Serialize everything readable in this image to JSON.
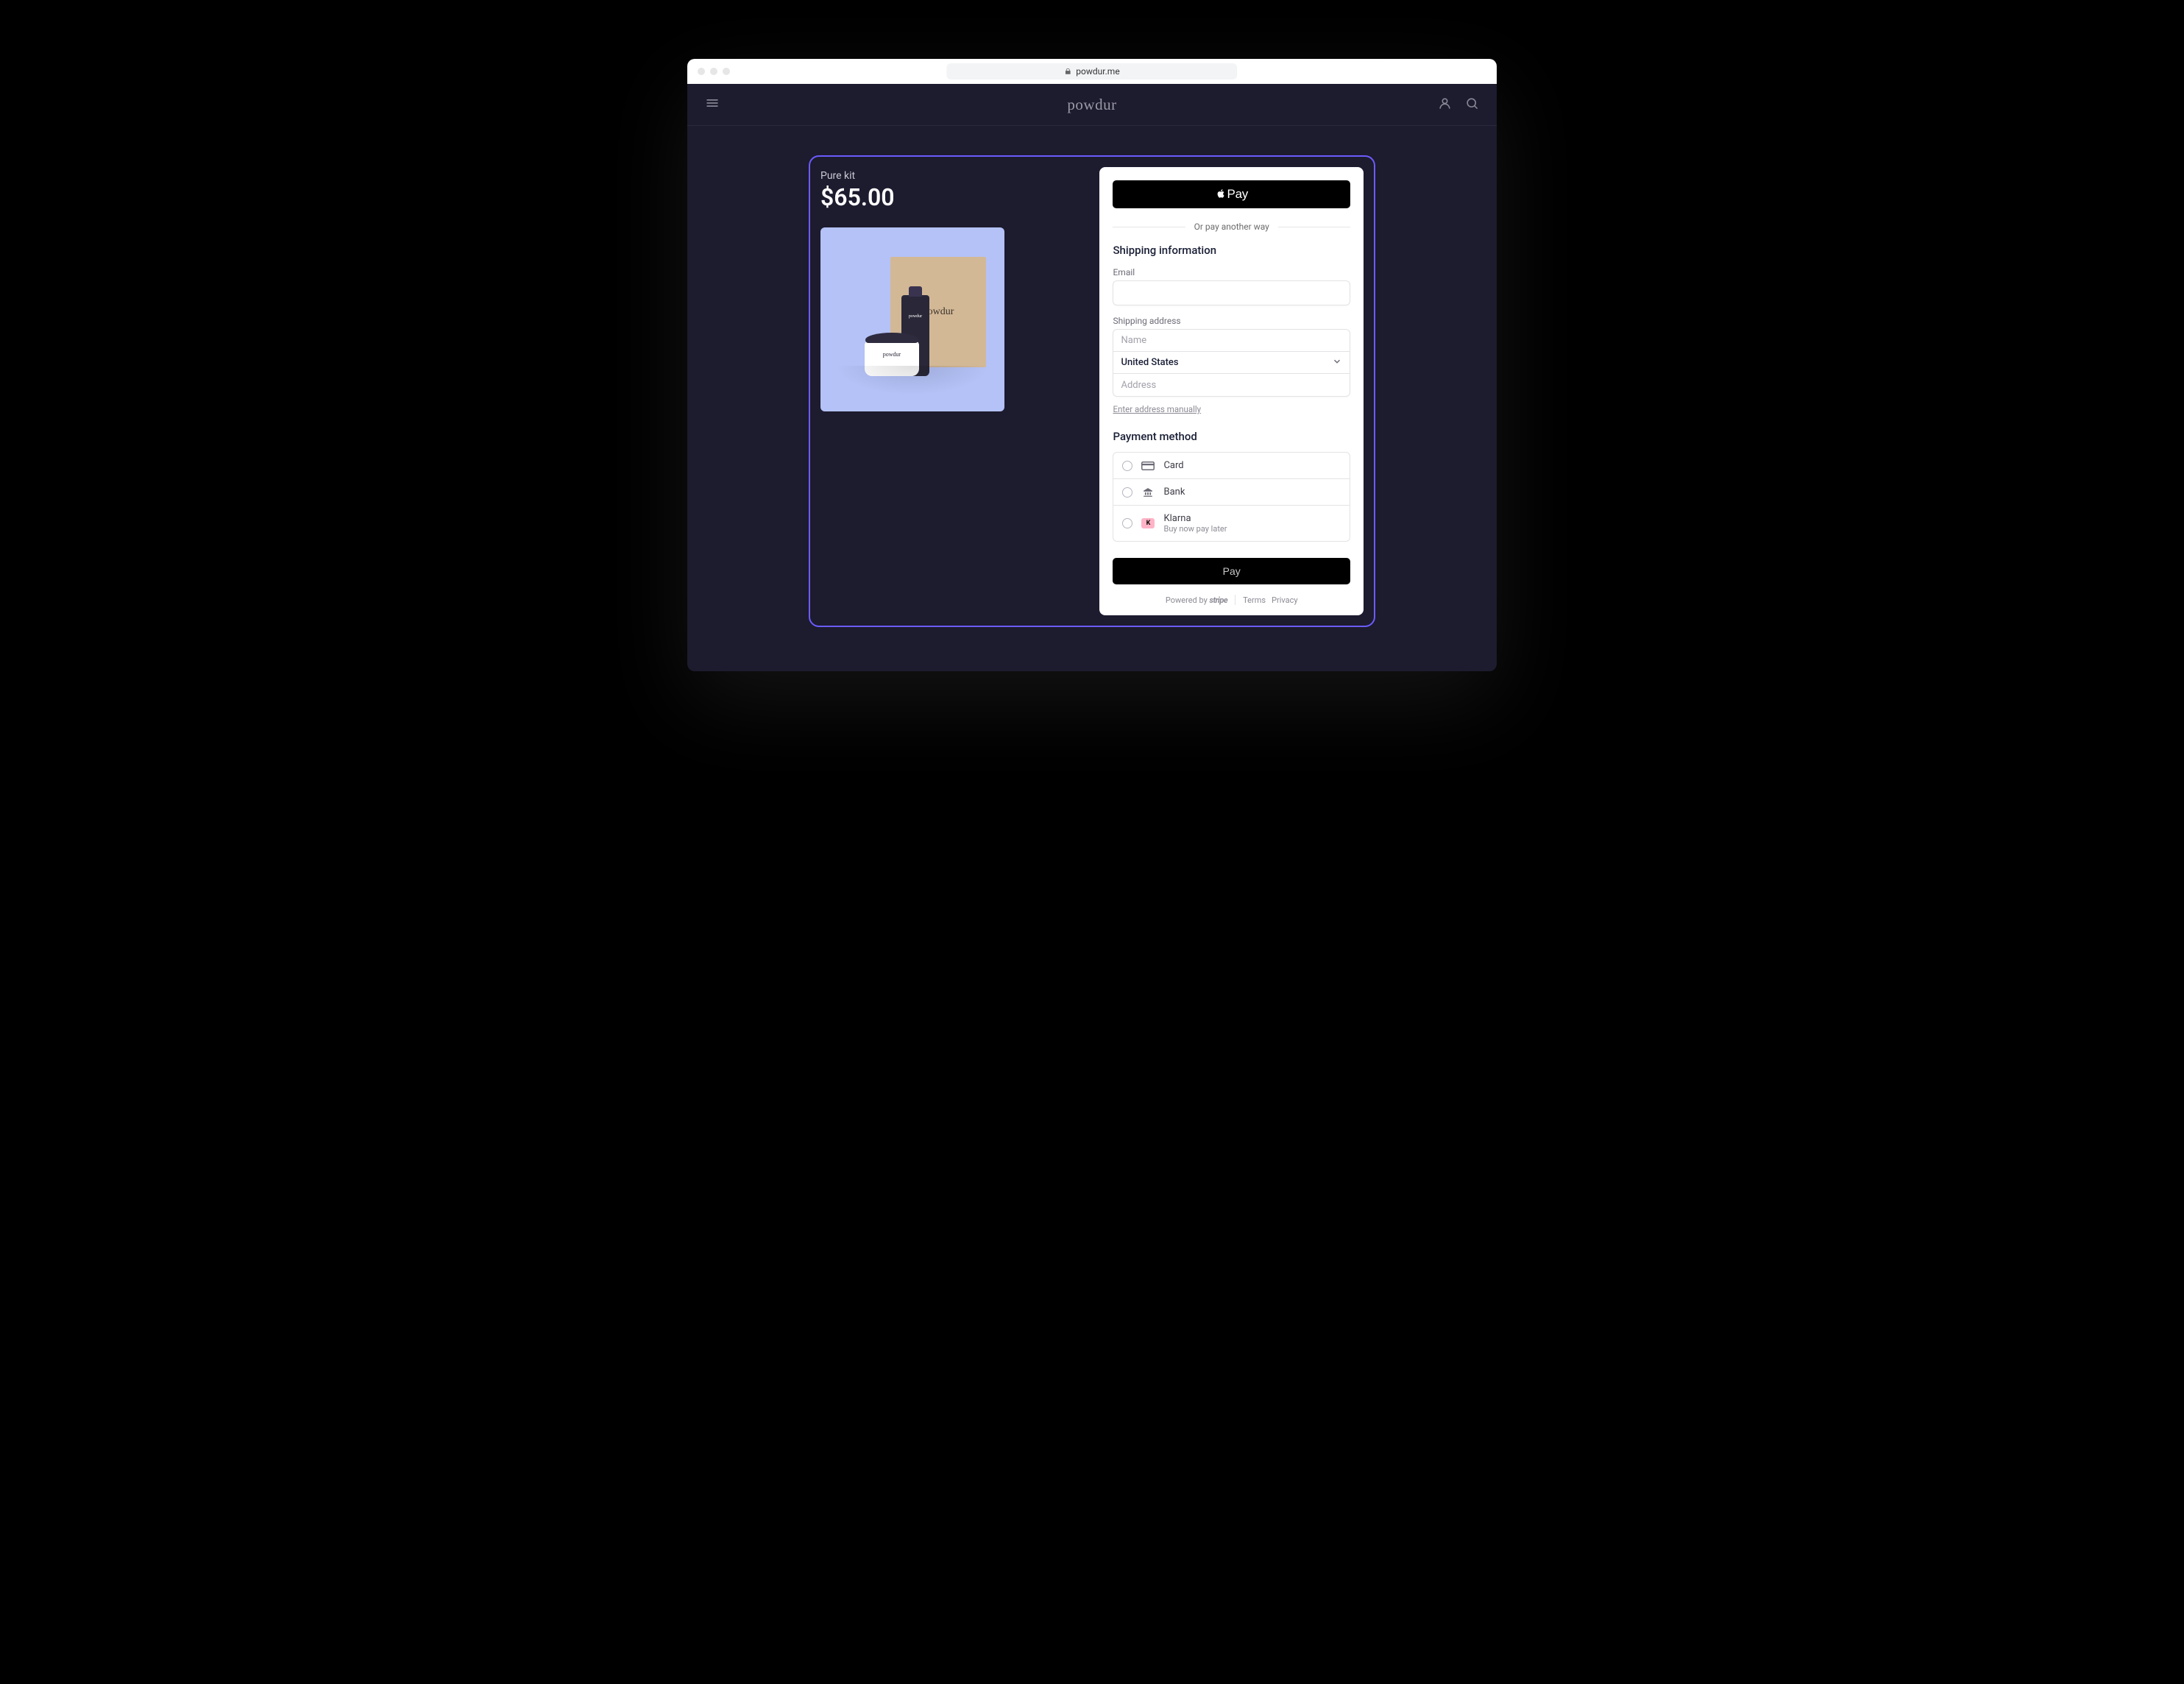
{
  "browser": {
    "url": "powdur.me"
  },
  "header": {
    "brand": "powdur"
  },
  "product": {
    "name": "Pure kit",
    "price": "$65.00"
  },
  "checkout": {
    "apple_pay_label": "Pay",
    "divider": "Or pay another way",
    "shipping_title": "Shipping information",
    "email_label": "Email",
    "email_value": "",
    "shipping_address_label": "Shipping address",
    "name_placeholder": "Name",
    "country_value": "United States",
    "address_placeholder": "Address",
    "manual_link": "Enter address manually",
    "payment_title": "Payment method",
    "methods": [
      {
        "name": "Card",
        "sub": ""
      },
      {
        "name": "Bank",
        "sub": ""
      },
      {
        "name": "Klarna",
        "sub": "Buy now pay later"
      }
    ],
    "pay_button": "Pay",
    "footer": {
      "powered_by": "Powered by",
      "stripe": "stripe",
      "terms": "Terms",
      "privacy": "Privacy"
    }
  }
}
